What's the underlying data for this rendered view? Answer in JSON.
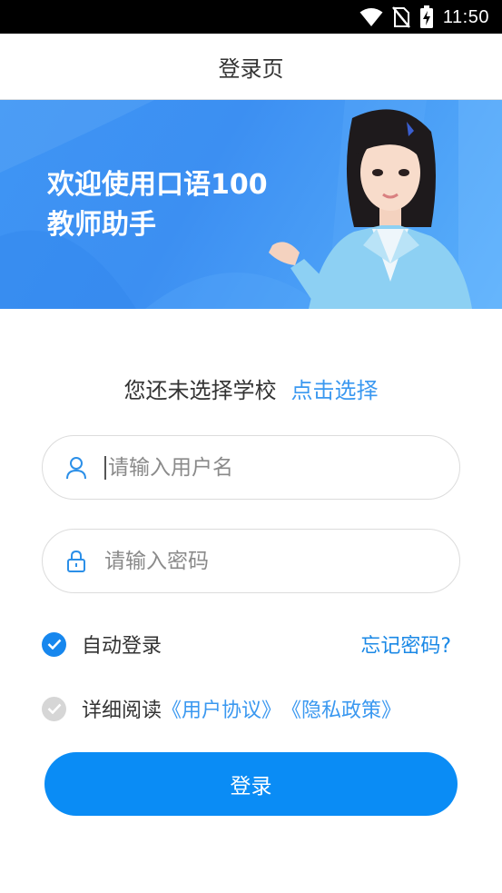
{
  "status_bar": {
    "time": "11:50"
  },
  "nav": {
    "title": "登录页"
  },
  "banner": {
    "line1": "欢迎使用口语100",
    "line2": "教师助手"
  },
  "school": {
    "prompt": "您还未选择学校",
    "select_link": "点击选择"
  },
  "username": {
    "placeholder": "请输入用户名",
    "value": ""
  },
  "password": {
    "placeholder": "请输入密码",
    "value": ""
  },
  "auto_login": {
    "label": "自动登录",
    "checked": true
  },
  "forgot_password": {
    "label": "忘记密码?"
  },
  "agreement": {
    "prefix": "详细阅读",
    "user_agreement": "《用户协议》",
    "privacy_policy": "《隐私政策》",
    "checked": false
  },
  "login_button": {
    "label": "登录"
  },
  "colors": {
    "accent": "#0a8cf5",
    "link": "#3a98f0",
    "banner": "#3f95f4"
  }
}
